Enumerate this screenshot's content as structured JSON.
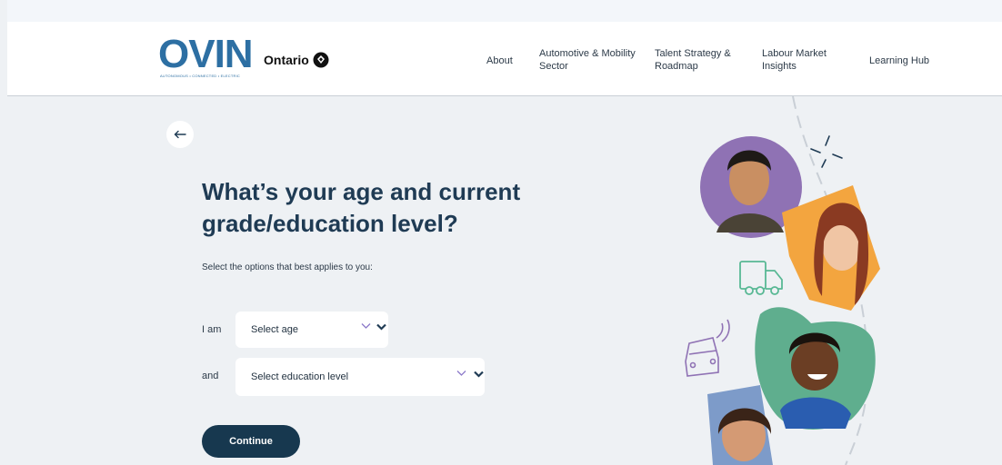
{
  "header": {
    "logo_text": "OVIN",
    "logo_tagline": "AUTONOMOUS • CONNECTED • ELECTRIC",
    "ontario_label": "Ontario",
    "nav": [
      {
        "line1": "About",
        "line2": ""
      },
      {
        "line1": "Automotive & Mobility",
        "line2": "Sector"
      },
      {
        "line1": "Talent Strategy &",
        "line2": "Roadmap"
      },
      {
        "line1": "Labour Market",
        "line2": "Insights"
      },
      {
        "line1": "Learning Hub",
        "line2": ""
      }
    ]
  },
  "main": {
    "title_line1": "What’s your age and current",
    "title_line2": "grade/education level?",
    "subtitle": "Select the options that best applies to you:",
    "age_label": "I am",
    "age_select": "Select age",
    "edu_label": "and",
    "edu_select": "Select education level",
    "continue_label": "Continue"
  },
  "colors": {
    "brand": "#2d6fa3",
    "title": "#1f3b54",
    "button": "#17384f",
    "page_bg": "#eef1f4"
  },
  "icons": [
    "back-arrow-icon",
    "chevron-down-icon",
    "ontario-trillium-icon",
    "truck-icon",
    "car-icon"
  ]
}
